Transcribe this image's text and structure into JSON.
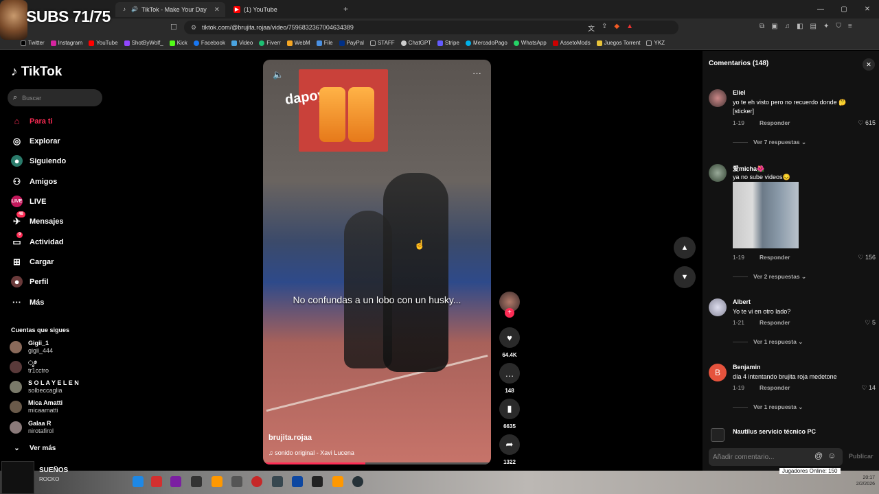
{
  "browser": {
    "tabs": [
      {
        "label": "TikTok - Make Your Day",
        "active": true
      },
      {
        "label": "(1) YouTube",
        "active": false
      }
    ],
    "url": "tiktok.com/@brujita.rojaa/video/7596832367004634389",
    "bookmarks": [
      "Twitter",
      "Instagram",
      "YouTube",
      "ShotByWolf_",
      "Kick",
      "Facebook",
      "Video",
      "Fiverr",
      "WebM",
      "File",
      "PayPal",
      "STAFF",
      "ChatGPT",
      "Stripe",
      "MercadoPago",
      "WhatsApp",
      "AssetoMods",
      "Juegos Torrent",
      "YKZ"
    ]
  },
  "overlay": {
    "subs": "SUBS 71/75"
  },
  "sidebar": {
    "logo": "TikTok",
    "search_placeholder": "Buscar",
    "nav": [
      {
        "label": "Para ti",
        "icon": "home-icon"
      },
      {
        "label": "Explorar",
        "icon": "compass-icon"
      },
      {
        "label": "Siguiendo",
        "icon": "following-icon"
      },
      {
        "label": "Amigos",
        "icon": "friends-icon"
      },
      {
        "label": "LIVE",
        "icon": "live-icon"
      },
      {
        "label": "Mensajes",
        "icon": "messages-icon",
        "badge": "48"
      },
      {
        "label": "Actividad",
        "icon": "activity-icon",
        "badge": "9"
      },
      {
        "label": "Cargar",
        "icon": "upload-icon"
      },
      {
        "label": "Perfil",
        "icon": "profile-icon"
      },
      {
        "label": "Más",
        "icon": "more-icon"
      }
    ],
    "following_title": "Cuentas que sigues",
    "following": [
      {
        "name": "Gigii_1",
        "handle": "gigii_444"
      },
      {
        "name": "ೃ࿔",
        "handle": "tr1cctro"
      },
      {
        "name": "S O L A Y E L E N",
        "handle": "solbeccaglia"
      },
      {
        "name": "Mica Amatti",
        "handle": "micaamatti"
      },
      {
        "name": "Galaa R",
        "handle": "nirotafirol"
      }
    ],
    "see_more": "Ver más"
  },
  "video": {
    "caption": "No confundas a un lobo con un husky...",
    "author": "brujita.rojaa",
    "sound": "sonido original - Xavi Lucena",
    "poster_text": "dapoy",
    "progress": 0.45,
    "likes": "64.4K",
    "comments": "148",
    "saves": "6635",
    "shares": "1322"
  },
  "comments": {
    "title": "Comentarios",
    "count": "(148)",
    "items": [
      {
        "name": "Eliel",
        "text": "yo te eh visto pero no recuerdo donde 🤔 [sticker]",
        "date": "1-19",
        "likes": "615",
        "more": "Ver 7 respuestas"
      },
      {
        "name": "爱micha🌺",
        "text": "ya no sube videos😔",
        "date": "1-19",
        "likes": "156",
        "more": "Ver 2 respuestas"
      },
      {
        "name": "Albert",
        "text": "Yo te vi en otro lado?",
        "date": "1-21",
        "likes": "5",
        "more": "Ver 1 respuesta"
      },
      {
        "name": "Benjamin",
        "text": "día 4 intentando brujita roja medetone",
        "date": "1-19",
        "likes": "14",
        "more": "Ver 1 respuesta"
      },
      {
        "name": "Nautilus servicio técnico PC",
        "text": "",
        "date": "",
        "likes": "",
        "more": ""
      }
    ],
    "reply_label": "Responder",
    "input_placeholder": "Añadir comentario...",
    "publish": "Publicar"
  },
  "taskbar": {
    "now_playing_title": "SUEÑOS",
    "now_playing_artist": "ROCKO",
    "online": "Jugadores Online: 150",
    "time": "20:17",
    "date": "2/2/2026"
  }
}
